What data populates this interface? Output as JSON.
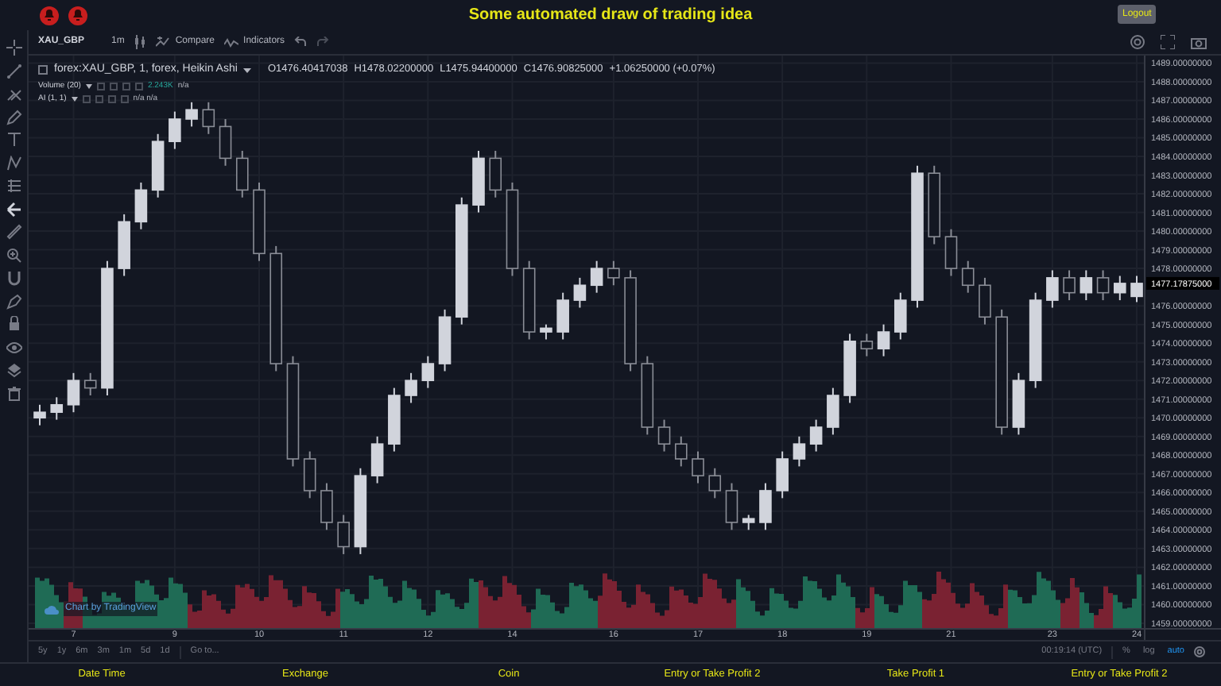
{
  "header": {
    "title": "Some automated draw of trading idea",
    "logout_button": "Logout"
  },
  "toolbar": {
    "symbol": "XAU_GBP",
    "interval": "1m",
    "compare": "Compare",
    "indicators": "Indicators"
  },
  "legend": {
    "checked": false,
    "series": "forex:XAU_GBP, 1, forex, Heikin Ashi",
    "ohlc": [
      "O1476.40417038",
      "H1478.02200000",
      "L1475.94400000",
      "C1476.90825000",
      "+1.06250000 (+0.07%)"
    ],
    "studies": [
      {
        "name": "Volume (20)",
        "value": "2.243K",
        "extra": "n/a"
      },
      {
        "name": "AI (1, 1)",
        "extra": "n/a n/a"
      }
    ]
  },
  "chart": {
    "credit": "Chart by TradingView",
    "price_label": "1477.17875000",
    "chart_data": {
      "type": "candlestick",
      "grid": true,
      "ylim": [
        1458.7,
        1489.4
      ],
      "categories": [
        null,
        null,
        "7",
        null,
        null,
        null,
        null,
        null,
        "9",
        null,
        null,
        null,
        null,
        "10",
        null,
        null,
        null,
        null,
        "11",
        null,
        null,
        null,
        null,
        "12",
        null,
        null,
        null,
        null,
        "14",
        null,
        null,
        null,
        null,
        null,
        "16",
        null,
        null,
        null,
        null,
        "17",
        null,
        null,
        null,
        null,
        "18",
        null,
        null,
        null,
        null,
        "19",
        null,
        null,
        null,
        null,
        "21",
        null,
        null,
        null,
        null,
        null,
        "23",
        null,
        null,
        null,
        null,
        "24"
      ],
      "ohlc": [
        [
          1470.0,
          1470.7,
          1469.6,
          1470.3
        ],
        [
          1470.3,
          1471.1,
          1469.9,
          1470.7
        ],
        [
          1470.7,
          1472.4,
          1470.3,
          1472
        ],
        [
          1472,
          1472.4,
          1471.2,
          1471.6
        ],
        [
          1471.6,
          1478.4,
          1471.2,
          1478
        ],
        [
          1478,
          1480.9,
          1477.6,
          1480.5
        ],
        [
          1480.5,
          1482.6,
          1480.1,
          1482.2
        ],
        [
          1482.2,
          1485.2,
          1481.8,
          1484.8
        ],
        [
          1484.8,
          1486.4,
          1484.4,
          1486
        ],
        [
          1486,
          1486.9,
          1485.6,
          1486.5
        ],
        [
          1486.5,
          1486.9,
          1485.2,
          1485.6
        ],
        [
          1485.6,
          1486,
          1483.5,
          1483.9
        ],
        [
          1483.9,
          1484.3,
          1481.8,
          1482.2
        ],
        [
          1482.2,
          1482.6,
          1478.4,
          1478.8
        ],
        [
          1478.8,
          1479.2,
          1472.5,
          1472.9
        ],
        [
          1472.9,
          1473.3,
          1467.4,
          1467.8
        ],
        [
          1467.8,
          1468.2,
          1465.7,
          1466.1
        ],
        [
          1466.1,
          1466.5,
          1464,
          1464.4
        ],
        [
          1464.4,
          1464.8,
          1462.7,
          1463.1
        ],
        [
          1463.1,
          1467.3,
          1462.7,
          1466.9
        ],
        [
          1466.9,
          1469,
          1466.5,
          1468.6
        ],
        [
          1468.6,
          1471.6,
          1468.2,
          1471.2
        ],
        [
          1471.2,
          1472.4,
          1470.8,
          1472
        ],
        [
          1472,
          1473.3,
          1471.6,
          1472.9
        ],
        [
          1472.9,
          1475.8,
          1472.5,
          1475.4
        ],
        [
          1475.4,
          1481.8,
          1475,
          1481.4
        ],
        [
          1481.4,
          1484.3,
          1481,
          1483.9
        ],
        [
          1483.9,
          1484.3,
          1481.8,
          1482.2
        ],
        [
          1482.2,
          1482.6,
          1477.6,
          1478
        ],
        [
          1478,
          1478.4,
          1474.2,
          1474.6
        ],
        [
          1474.6,
          1475,
          1474.2,
          1474.8
        ],
        [
          1474.6,
          1476.7,
          1474.2,
          1476.3
        ],
        [
          1476.3,
          1477.5,
          1475.9,
          1477.1
        ],
        [
          1477.1,
          1478.4,
          1476.7,
          1478
        ],
        [
          1478,
          1478.4,
          1477.1,
          1477.5
        ],
        [
          1477.5,
          1477.9,
          1472.5,
          1472.9
        ],
        [
          1472.9,
          1473.3,
          1469.1,
          1469.5
        ],
        [
          1469.5,
          1469.9,
          1468.2,
          1468.6
        ],
        [
          1468.6,
          1469,
          1467.4,
          1467.8
        ],
        [
          1467.8,
          1468.2,
          1466.5,
          1466.9
        ],
        [
          1466.9,
          1467.3,
          1465.7,
          1466.1
        ],
        [
          1466.1,
          1466.5,
          1464,
          1464.4
        ],
        [
          1464.4,
          1464.8,
          1464,
          1464.6
        ],
        [
          1464.4,
          1466.5,
          1464,
          1466.1
        ],
        [
          1466.1,
          1468.2,
          1465.7,
          1467.8
        ],
        [
          1467.8,
          1469,
          1467.4,
          1468.6
        ],
        [
          1468.6,
          1469.9,
          1468.2,
          1469.5
        ],
        [
          1469.5,
          1471.6,
          1469.1,
          1471.2
        ],
        [
          1471.2,
          1474.5,
          1470.8,
          1474.1
        ],
        [
          1474.1,
          1474.5,
          1473.3,
          1473.7
        ],
        [
          1473.7,
          1475,
          1473.3,
          1474.6
        ],
        [
          1474.6,
          1476.7,
          1474.2,
          1476.3
        ],
        [
          1476.3,
          1483.5,
          1475.9,
          1483.1
        ],
        [
          1483.1,
          1483.5,
          1479.3,
          1479.7
        ],
        [
          1479.7,
          1480.1,
          1477.6,
          1478
        ],
        [
          1478,
          1478.4,
          1476.7,
          1477.1
        ],
        [
          1477.1,
          1477.5,
          1475,
          1475.4
        ],
        [
          1475.4,
          1475.8,
          1469.1,
          1469.5
        ],
        [
          1469.5,
          1472.4,
          1469.1,
          1472
        ],
        [
          1472,
          1476.7,
          1471.6,
          1476.3
        ],
        [
          1476.3,
          1477.9,
          1475.9,
          1477.5
        ],
        [
          1477.5,
          1477.9,
          1476.3,
          1476.7
        ],
        [
          1476.7,
          1477.9,
          1476.3,
          1477.5
        ],
        [
          1477.5,
          1477.9,
          1476.3,
          1476.7
        ],
        [
          1476.7,
          1477.6,
          1476.3,
          1477.2
        ],
        [
          1476.5,
          1477.6,
          1476.2,
          1477.2
        ]
      ],
      "yticks": [
        {
          "value": 1459,
          "label": "1459.00000000"
        },
        {
          "value": 1460,
          "label": "1460.00000000"
        },
        {
          "value": 1461,
          "label": "1461.00000000"
        },
        {
          "value": 1462,
          "label": "1462.00000000"
        },
        {
          "value": 1463,
          "label": "1463.00000000"
        },
        {
          "value": 1464,
          "label": "1464.00000000"
        },
        {
          "value": 1465,
          "label": "1465.00000000"
        },
        {
          "value": 1466,
          "label": "1466.00000000"
        },
        {
          "value": 1467,
          "label": "1467.00000000"
        },
        {
          "value": 1468,
          "label": "1468.00000000"
        },
        {
          "value": 1469,
          "label": "1469.00000000"
        },
        {
          "value": 1470,
          "label": "1470.00000000"
        },
        {
          "value": 1471,
          "label": "1471.00000000"
        },
        {
          "value": 1472,
          "label": "1472.00000000"
        },
        {
          "value": 1473,
          "label": "1473.00000000"
        },
        {
          "value": 1474,
          "label": "1474.00000000"
        },
        {
          "value": 1475,
          "label": "1475.00000000"
        },
        {
          "value": 1476,
          "label": "1476.00000000"
        },
        {
          "value": 1478,
          "label": "1478.00000000"
        },
        {
          "value": 1479,
          "label": "1479.00000000"
        },
        {
          "value": 1480,
          "label": "1480.00000000"
        },
        {
          "value": 1481,
          "label": "1481.00000000"
        },
        {
          "value": 1482,
          "label": "1482.00000000"
        },
        {
          "value": 1483,
          "label": "1483.00000000"
        },
        {
          "value": 1484,
          "label": "1484.00000000"
        },
        {
          "value": 1485,
          "label": "1485.00000000"
        },
        {
          "value": 1486,
          "label": "1486.00000000"
        },
        {
          "value": 1487,
          "label": "1487.00000000"
        },
        {
          "value": 1488,
          "label": "1488.00000000"
        },
        {
          "value": 1489,
          "label": "1489.00000000"
        }
      ]
    }
  },
  "range_bar": {
    "ranges": [
      {
        "label": "5y",
        "selected": false
      },
      {
        "label": "1y",
        "selected": false
      },
      {
        "label": "6m",
        "selected": false
      },
      {
        "label": "3m",
        "selected": false
      },
      {
        "label": "1m",
        "selected": false
      },
      {
        "label": "5d",
        "selected": false
      },
      {
        "label": "1d",
        "selected": false
      }
    ],
    "goto": "Go to...",
    "clock": "00:19:14 (UTC)",
    "scale_options": [
      {
        "label": "%",
        "selected": false
      },
      {
        "label": "log",
        "selected": false
      },
      {
        "label": "auto",
        "selected": true
      }
    ]
  },
  "footer": [
    "Date Time",
    "Exchange",
    "Coin",
    "Entry or Take Profit 2",
    "Take Profit 1",
    "Entry or Take Profit 2"
  ]
}
